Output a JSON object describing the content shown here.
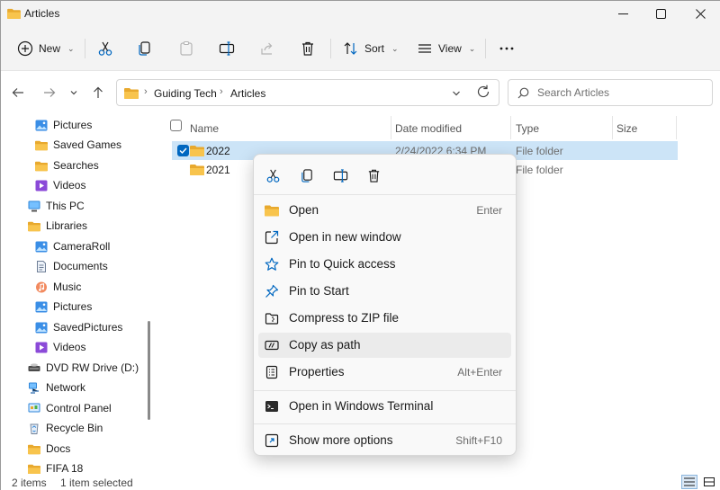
{
  "window": {
    "title": "Articles"
  },
  "commandbar": {
    "new_label": "New",
    "sort_label": "Sort",
    "view_label": "View"
  },
  "address": {
    "crumbs": [
      "Guiding Tech",
      "Articles"
    ]
  },
  "search": {
    "placeholder": "Search Articles"
  },
  "sidebar": {
    "items": [
      {
        "label": "Pictures",
        "icon": "pictures-icon"
      },
      {
        "label": "Saved Games",
        "icon": "folder-icon"
      },
      {
        "label": "Searches",
        "icon": "folder-icon"
      },
      {
        "label": "Videos",
        "icon": "videos-icon"
      },
      {
        "label": "This PC",
        "icon": "computer-icon"
      },
      {
        "label": "Libraries",
        "icon": "folder-icon"
      },
      {
        "label": "CameraRoll",
        "icon": "pictures-icon"
      },
      {
        "label": "Documents",
        "icon": "documents-icon"
      },
      {
        "label": "Music",
        "icon": "music-icon"
      },
      {
        "label": "Pictures",
        "icon": "pictures-icon"
      },
      {
        "label": "SavedPictures",
        "icon": "pictures-icon"
      },
      {
        "label": "Videos",
        "icon": "videos-icon"
      },
      {
        "label": "DVD RW Drive (D:)",
        "icon": "dvd-drive-icon"
      },
      {
        "label": "Network",
        "icon": "network-icon"
      },
      {
        "label": "Control Panel",
        "icon": "control-panel-icon"
      },
      {
        "label": "Recycle Bin",
        "icon": "recycle-bin-icon"
      },
      {
        "label": "Docs",
        "icon": "folder-icon"
      },
      {
        "label": "FIFA 18",
        "icon": "folder-icon"
      }
    ]
  },
  "filelist": {
    "columns": {
      "name": "Name",
      "date": "Date modified",
      "type": "Type",
      "size": "Size"
    },
    "rows": [
      {
        "name": "2022",
        "date": "2/24/2022 6:34 PM",
        "type": "File folder",
        "selected": true
      },
      {
        "name": "2021",
        "date": "",
        "type": "File folder",
        "selected": false
      }
    ]
  },
  "context_menu": {
    "quick_actions": [
      "cut-icon",
      "copy-icon",
      "rename-icon",
      "delete-icon"
    ],
    "items": [
      {
        "label": "Open",
        "shortcut": "Enter",
        "icon": "folder-icon"
      },
      {
        "label": "Open in new window",
        "shortcut": "",
        "icon": "open-new-window-icon"
      },
      {
        "label": "Pin to Quick access",
        "shortcut": "",
        "icon": "star-icon"
      },
      {
        "label": "Pin to Start",
        "shortcut": "",
        "icon": "pin-icon"
      },
      {
        "label": "Compress to ZIP file",
        "shortcut": "",
        "icon": "zip-icon"
      },
      {
        "label": "Copy as path",
        "shortcut": "",
        "icon": "copy-path-icon",
        "hovered": true
      },
      {
        "label": "Properties",
        "shortcut": "Alt+Enter",
        "icon": "properties-icon"
      },
      {
        "label": "Open in Windows Terminal",
        "shortcut": "",
        "icon": "terminal-icon"
      },
      {
        "label": "Show more options",
        "shortcut": "Shift+F10",
        "icon": "more-options-icon"
      }
    ]
  },
  "statusbar": {
    "count": "2 items",
    "selection": "1 item selected"
  },
  "colors": {
    "accent": "#0067c0",
    "folder": "#f8c44d",
    "selection": "#cce4f7",
    "menu_background": "#f9f9f9"
  }
}
